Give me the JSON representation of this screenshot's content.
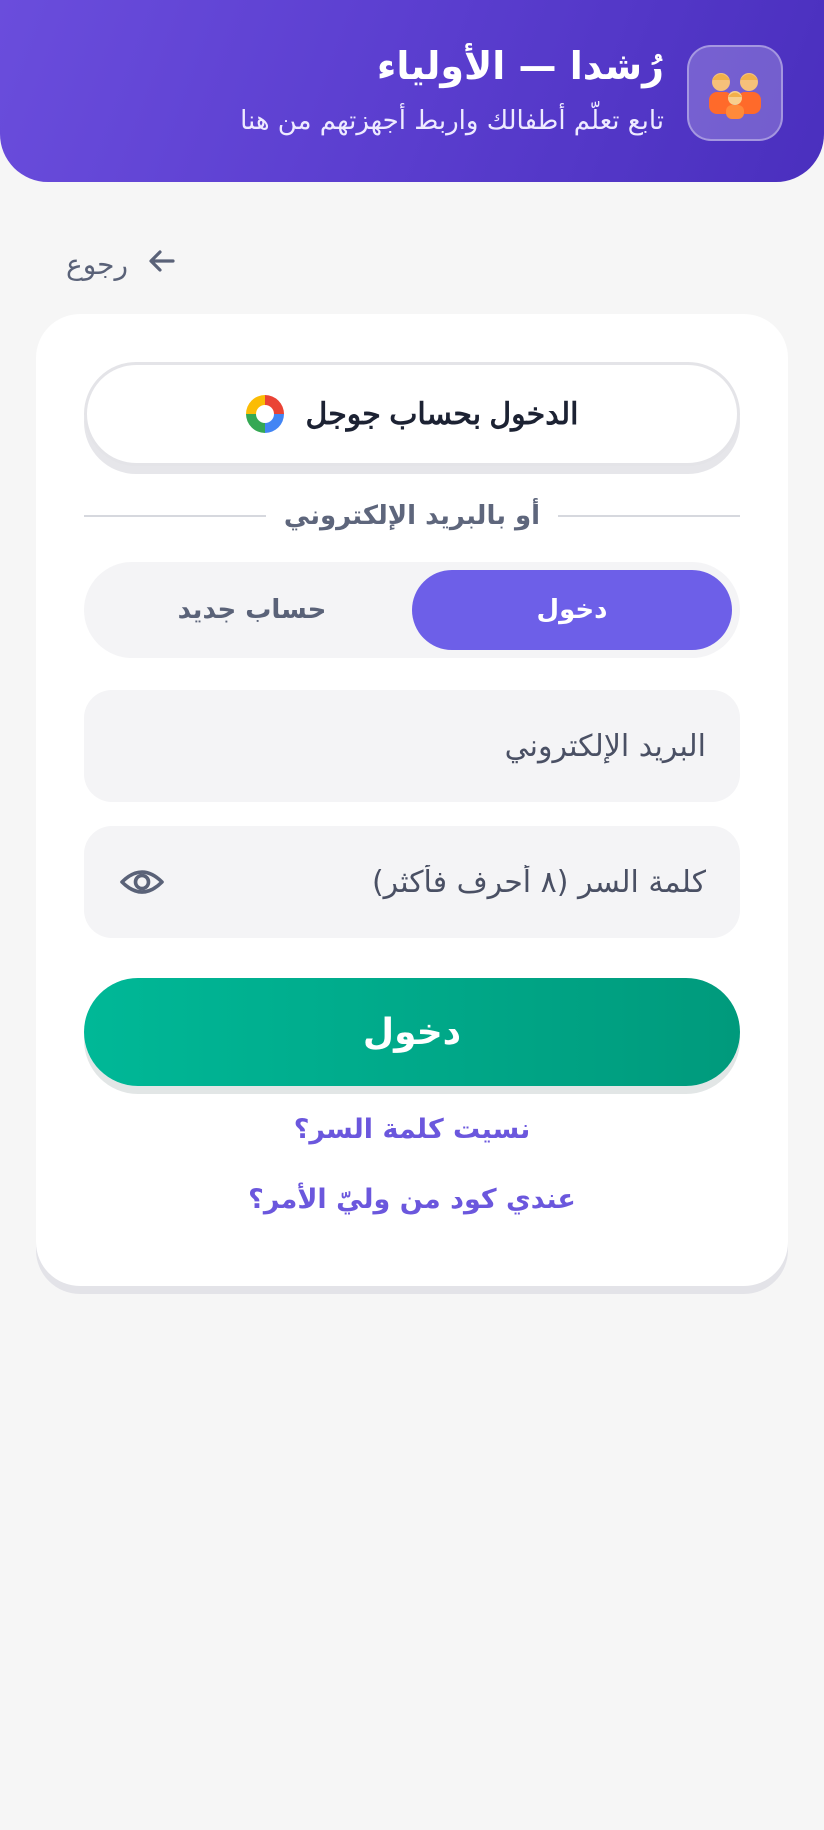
{
  "header": {
    "title": "رُشدا — الأولياء",
    "subtitle": "تابع تعلّم أطفالك واربط أجهزتهم من هنا",
    "logo_icon": "family-icon"
  },
  "back": {
    "label": "رجوع",
    "icon": "arrow-left-icon"
  },
  "auth": {
    "google_label": "الدخول بحساب جوجل",
    "divider_text": "أو بالبريد الإلكتروني",
    "tabs": [
      {
        "label": "دخول",
        "active": true
      },
      {
        "label": "حساب جديد",
        "active": false
      }
    ],
    "email_placeholder": "البريد الإلكتروني",
    "email_value": "",
    "password_placeholder": "كلمة السر (٨ أحرف فأكثر)",
    "password_value": "",
    "submit_label": "دخول",
    "forgot_label": "نسيت كلمة السر؟",
    "code_label": "عندي كود من وليّ الأمر؟"
  },
  "colors": {
    "header_gradient_start": "#6a4ddc",
    "header_gradient_end": "#4a2fbe",
    "accent_purple": "#6d5fe8",
    "submit_green": "#00b897",
    "link_purple": "#6b57dd"
  }
}
